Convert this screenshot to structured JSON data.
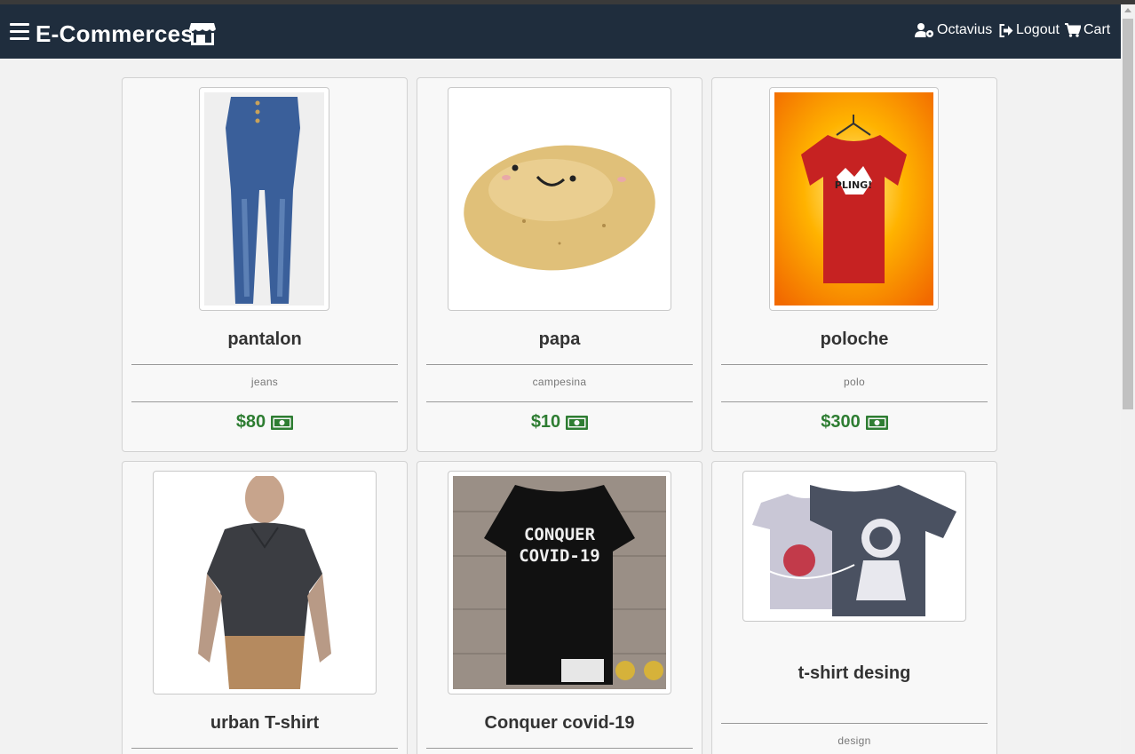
{
  "navbar": {
    "brand": "E-Commerces",
    "user_name": "Octavius",
    "logout_label": "Logout",
    "cart_label": "Cart",
    "icons": [
      "menu-icon",
      "store-icon",
      "user-settings-icon",
      "logout-icon",
      "cart-icon"
    ]
  },
  "products": [
    {
      "name": "pantalon",
      "description": "jeans",
      "price": "$80",
      "image": "jeans-photo"
    },
    {
      "name": "papa",
      "description": "campesina",
      "price": "$10",
      "image": "potato-photo"
    },
    {
      "name": "poloche",
      "description": "polo",
      "price": "$300",
      "image": "red-tshirt-photo"
    },
    {
      "name": "urban T-shirt",
      "description": "",
      "price": "",
      "image": "man-tshirt-photo"
    },
    {
      "name": "Conquer covid-19",
      "description": "",
      "price": "",
      "image": "black-tshirt-photo",
      "shirt_text": "CONQUER COVID-19"
    },
    {
      "name": "t-shirt desing",
      "description": "design",
      "price": "",
      "image": "astronaut-tshirt-photo"
    }
  ],
  "colors": {
    "navbar": "#1f2d3d",
    "price": "#2e7d32",
    "background": "#f2f2f2"
  }
}
